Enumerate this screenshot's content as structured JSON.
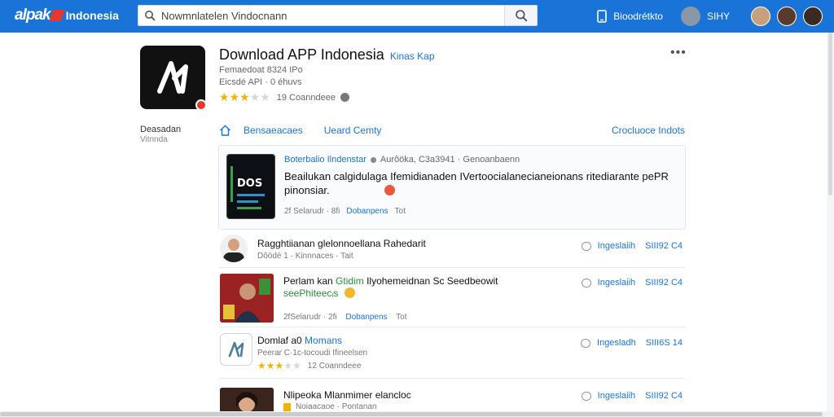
{
  "topbar": {
    "logo_text": "alpak",
    "logo_country": "Indonesia",
    "search_value": "Nowmnlatelen Vindocnann",
    "download_label": "Bioodrétkto",
    "user_label": "SIHY",
    "accent": "#1a73d6"
  },
  "app": {
    "title": "Download APP Indonesia",
    "title_tag": "Kinas Kap",
    "meta1": "Femaedoat 8324 IPo",
    "meta2": "Eicsdé API · 0 éhuvs",
    "rating_value": 3,
    "rating_max": 5,
    "rating_text": "19 Coanndeee",
    "more_label": "•••"
  },
  "side": {
    "label": "Deasadan",
    "sub": "Vitnnda"
  },
  "tabs": {
    "tab1": "Bensaeacaes",
    "tab2": "Ueard Cemty",
    "right": "Crocluoce Indots"
  },
  "featured": {
    "thumb_text": "DOS",
    "author": "Boterbalio Ilndenstar",
    "meta": "Aurôöka, C3a3941 · Genoanbaenn",
    "text_line1": "Beailukan calgidulaga Ifemidianaden IVertoocialanecianeionans ritediarante pePR",
    "text_line2": "pinonsiar.",
    "foot_left": "2f Selarudr · 8fi",
    "foot_link": "Dobanpens",
    "foot_right": "Tot"
  },
  "items": [
    {
      "title": "Ragghtiianan glelonnoellana Rahedarit",
      "sub": "Dôödé 1 · Kinnnaces · Tait",
      "reply": "Ingeslaiih",
      "count": "SIII92 C4"
    },
    {
      "title_part1": "Perlam kan",
      "title_link": "Gtidim",
      "title_part2": "Ilyohemeidnan Sc Seedbeowit",
      "title_line2": "seePhiteecᵢs",
      "foot_left": "2fSelarudr · 2fi",
      "foot_link": "Dobanpens",
      "foot_right": "Tot",
      "reply": "Ingeslaiih",
      "count": "SIII92 C4"
    },
    {
      "title_part1": "Domlaf a0",
      "title_link": "Momans",
      "sub": "Peerar C·1c-tocoudi Ifineelsen",
      "rating_text": "12 Coanndeee",
      "reply": "Ingesladh",
      "count": "SIII6S 14"
    },
    {
      "title": "Nlipeoka Mlanmimer elancloc",
      "sub": "Noiaacaoe · Pontanan",
      "reply": "Ingeslaiih",
      "count": "SIII92 C4"
    }
  ]
}
